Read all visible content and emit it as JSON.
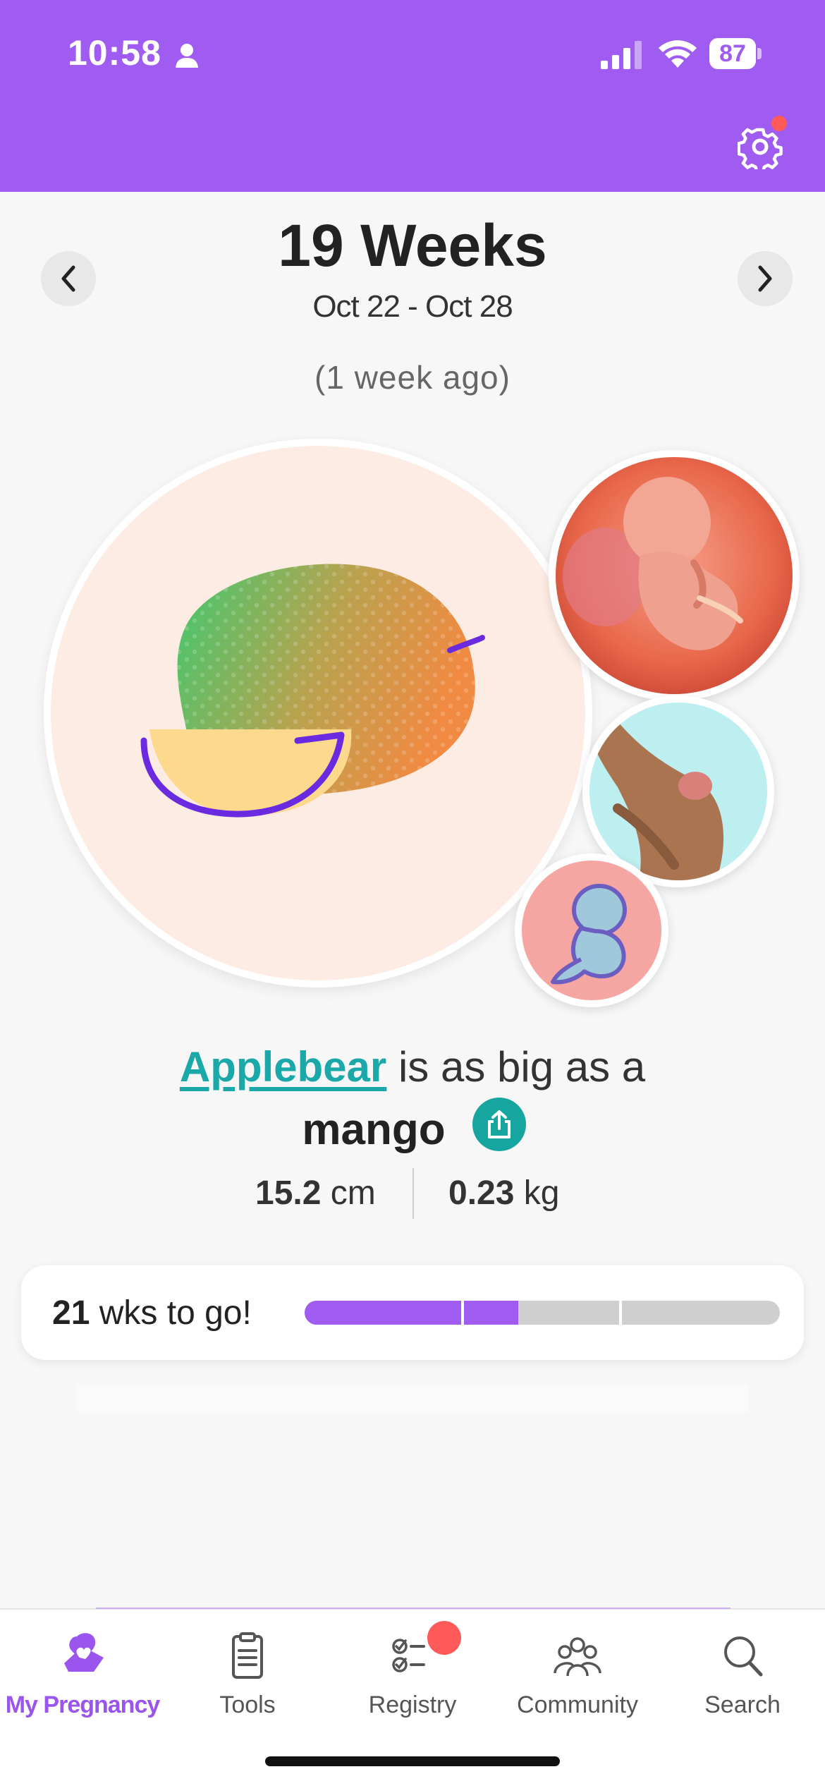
{
  "status_bar": {
    "time": "10:58",
    "battery": "87"
  },
  "header": {
    "settings_icon": "gear-icon",
    "accent": "#a05cf0"
  },
  "week": {
    "title": "19 Weeks",
    "range": "Oct 22 - Oct 28",
    "relative": "(1 week ago)"
  },
  "size_card": {
    "baby_name": "Applebear",
    "comparison_text": " is as big as a",
    "fruit": "mango",
    "length_value": "15.2",
    "length_unit": " cm",
    "weight_value": "0.23",
    "weight_unit": " kg"
  },
  "progress": {
    "weeks_left": "21",
    "label": " wks to go!",
    "fraction": 0.45
  },
  "tabs": [
    {
      "label": "My Pregnancy",
      "icon": "pregnancy-heart-icon",
      "active": true
    },
    {
      "label": "Tools",
      "icon": "clipboard-icon"
    },
    {
      "label": "Registry",
      "icon": "checklist-icon"
    },
    {
      "label": "Community",
      "icon": "people-icon"
    },
    {
      "label": "Search",
      "icon": "search-icon"
    }
  ],
  "colors": {
    "teal": "#17a59f",
    "badge": "#ff5a5a",
    "purple": "#9a55ef"
  }
}
